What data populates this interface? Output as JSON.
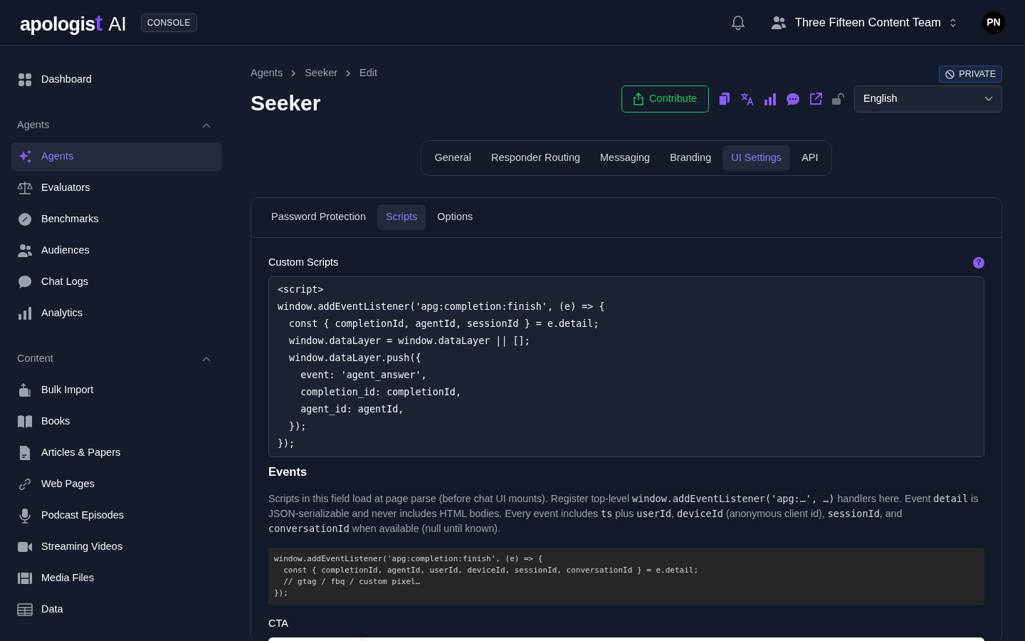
{
  "header": {
    "logo": {
      "text": "apologis",
      "accent": "t",
      "suffix": "AI"
    },
    "badge": "CONSOLE",
    "team": "Three Fifteen Content Team",
    "avatar": "PN"
  },
  "sidebar": {
    "top": [
      {
        "label": "Dashboard",
        "selected": false
      }
    ],
    "sections": [
      {
        "title": "Agents",
        "expanded": true,
        "items": [
          {
            "label": "Agents",
            "selected": true
          },
          {
            "label": "Evaluators",
            "selected": false
          },
          {
            "label": "Benchmarks",
            "selected": false
          },
          {
            "label": "Audiences",
            "selected": false
          },
          {
            "label": "Chat Logs",
            "selected": false
          },
          {
            "label": "Analytics",
            "selected": false
          }
        ]
      },
      {
        "title": "Content",
        "expanded": true,
        "items": [
          {
            "label": "Bulk Import",
            "selected": false
          },
          {
            "label": "Books",
            "selected": false
          },
          {
            "label": "Articles & Papers",
            "selected": false
          },
          {
            "label": "Web Pages",
            "selected": false
          },
          {
            "label": "Podcast Episodes",
            "selected": false
          },
          {
            "label": "Streaming Videos",
            "selected": false
          },
          {
            "label": "Media Files",
            "selected": false
          },
          {
            "label": "Data",
            "selected": false
          }
        ]
      }
    ]
  },
  "breadcrumb": [
    "Agents",
    "Seeker",
    "Edit"
  ],
  "title": "Seeker",
  "visibility": "PRIVATE",
  "contribute_button": "Contribute",
  "language": "English",
  "tabs": [
    {
      "label": "General",
      "selected": false
    },
    {
      "label": "Responder Routing",
      "selected": false
    },
    {
      "label": "Messaging",
      "selected": false
    },
    {
      "label": "Branding",
      "selected": false
    },
    {
      "label": "UI Settings",
      "selected": true
    },
    {
      "label": "API",
      "selected": false
    }
  ],
  "subtabs": [
    {
      "label": "Password Protection",
      "selected": false
    },
    {
      "label": "Scripts",
      "selected": true
    },
    {
      "label": "Options",
      "selected": false
    }
  ],
  "custom_scripts": {
    "label": "Custom Scripts",
    "help": "?",
    "value": "<script>\nwindow.addEventListener('apg:completion:finish', (e) => {\n  const { completionId, agentId, sessionId } = e.detail;\n  window.dataLayer = window.dataLayer || [];\n  window.dataLayer.push({\n    event: 'agent_answer',\n    completion_id: completionId,\n    agent_id: agentId,\n  });\n});"
  },
  "events": {
    "title": "Events",
    "description": [
      {
        "kind": "text",
        "text": "Scripts in this field load at page parse (before chat UI mounts). Register top-level "
      },
      {
        "kind": "code",
        "text": "window.addEventListener('apg:…', …)"
      },
      {
        "kind": "text",
        "text": " handlers here. Event "
      },
      {
        "kind": "code",
        "text": "detail"
      },
      {
        "kind": "text",
        "text": " is JSON-serializable and never includes HTML bodies. Every event includes "
      },
      {
        "kind": "code",
        "text": "ts"
      },
      {
        "kind": "text",
        "text": " plus "
      },
      {
        "kind": "code",
        "text": "userId"
      },
      {
        "kind": "text",
        "text": ", "
      },
      {
        "kind": "code",
        "text": "deviceId"
      },
      {
        "kind": "text",
        "text": " (anonymous client id), "
      },
      {
        "kind": "code",
        "text": "sessionId"
      },
      {
        "kind": "text",
        "text": ", and "
      },
      {
        "kind": "code",
        "text": "conversationId"
      },
      {
        "kind": "text",
        "text": " when available (null until known)."
      }
    ],
    "example": "window.addEventListener('apg:completion:finish', (e) => {\n  const { completionId, agentId, userId, deviceId, sessionId, conversationId } = e.detail;\n  // gtag / fbq / custom pixel…\n});"
  },
  "cta": {
    "title": "CTA"
  }
}
